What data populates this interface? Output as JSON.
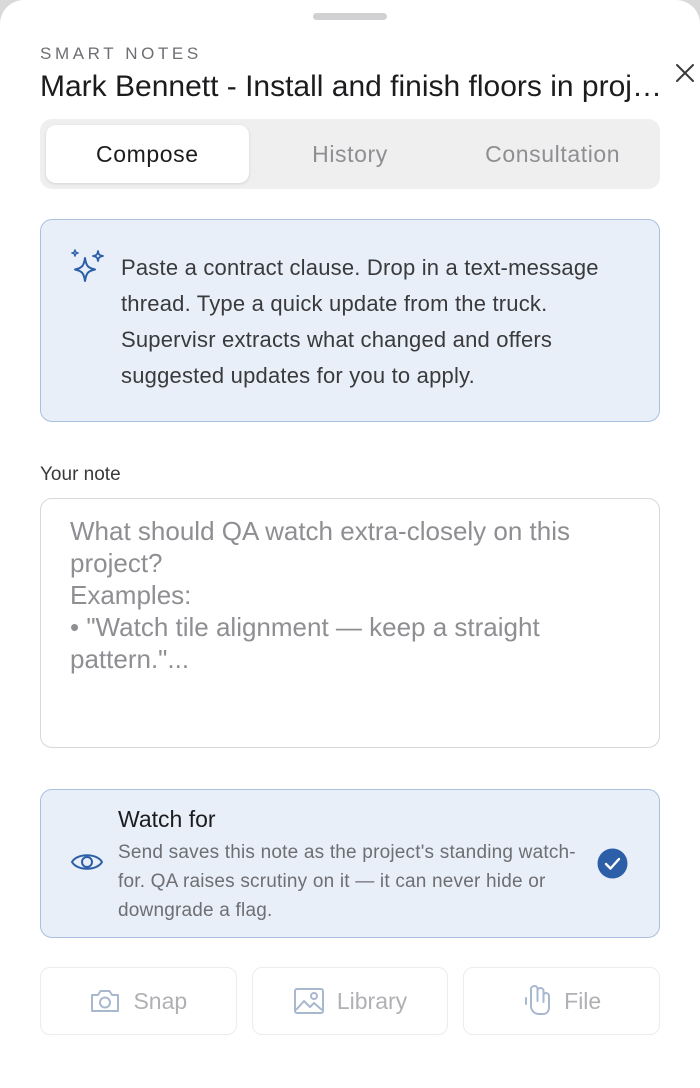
{
  "header": {
    "eyebrow": "SMART NOTES",
    "title": "Mark Bennett - Install and finish floors in project"
  },
  "tabs": [
    {
      "label": "Compose",
      "active": true
    },
    {
      "label": "History",
      "active": false
    },
    {
      "label": "Consultation",
      "active": false
    }
  ],
  "info": {
    "icon": "sparkles-icon",
    "text": "Paste a contract clause. Drop in a text-message thread. Type a quick update from the truck. Supervisr extracts what changed and offers suggested updates for you to apply."
  },
  "note": {
    "label": "Your note",
    "value": "",
    "placeholder": "What should QA watch extra-closely on this project?\nExamples:\n• \"Watch tile alignment — keep a straight pattern.\"..."
  },
  "watch_for": {
    "title": "Watch for",
    "description": "Send saves this note as the project's standing watch-for. QA raises scrutiny on it — it can never hide or downgrade a flag.",
    "checked": true,
    "icon": "eye-icon"
  },
  "attachments": [
    {
      "label": "Snap",
      "icon": "camera-icon"
    },
    {
      "label": "Library",
      "icon": "image-icon"
    },
    {
      "label": "File",
      "icon": "paperclip-icon"
    }
  ],
  "colors": {
    "accent": "#2c5fa8",
    "panel_bg": "#e8eff9",
    "panel_border": "#aac0de"
  }
}
